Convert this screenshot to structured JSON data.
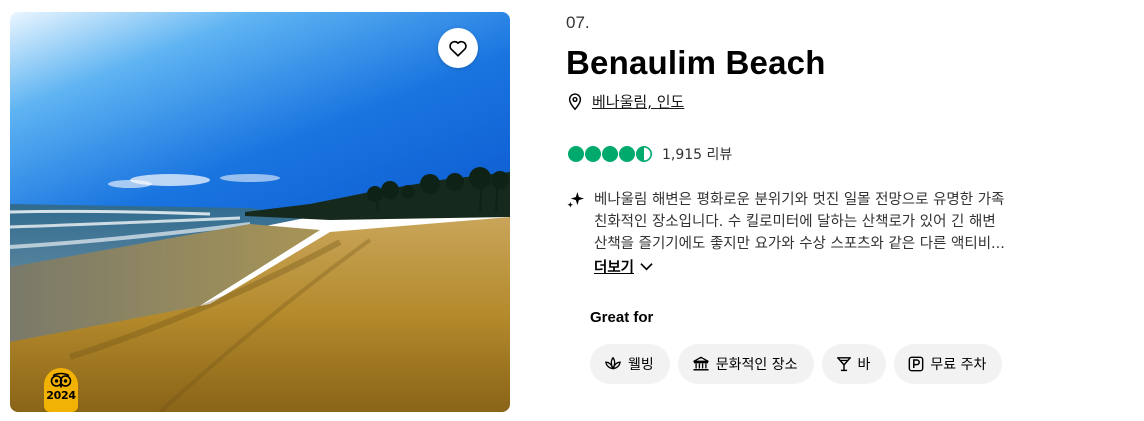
{
  "rank": "07.",
  "title": "Benaulim Beach",
  "location": {
    "text": "베나울림, 인도",
    "icon": "map-pin-icon"
  },
  "rating": {
    "score": 4.5,
    "max": 5,
    "reviews": "1,915 리뷰",
    "color": "#00aa6c"
  },
  "description": {
    "icon": "ai-sparkle-icon",
    "lines": [
      "베나울림 해변은 평화로운 분위기와 멋진 일몰 전망으로 유명한 가족",
      "친화적인 장소입니다. 수 킬로미터에 달하는 산책로가 있어 긴 해변",
      "산책을 즐기기에도 좋지만 요가와 수상 스포츠와 같은 다른 액티비..."
    ],
    "more_label": "더보기"
  },
  "great_for": {
    "heading": "Great for",
    "chips": [
      {
        "label": "웰빙",
        "icon": "lotus-icon"
      },
      {
        "label": "문화적인 장소",
        "icon": "museum-icon"
      },
      {
        "label": "바",
        "icon": "cocktail-icon"
      },
      {
        "label": "무료 주차",
        "icon": "parking-icon"
      }
    ]
  },
  "photo": {
    "badge_year": "2024",
    "save_icon": "heart-icon"
  }
}
